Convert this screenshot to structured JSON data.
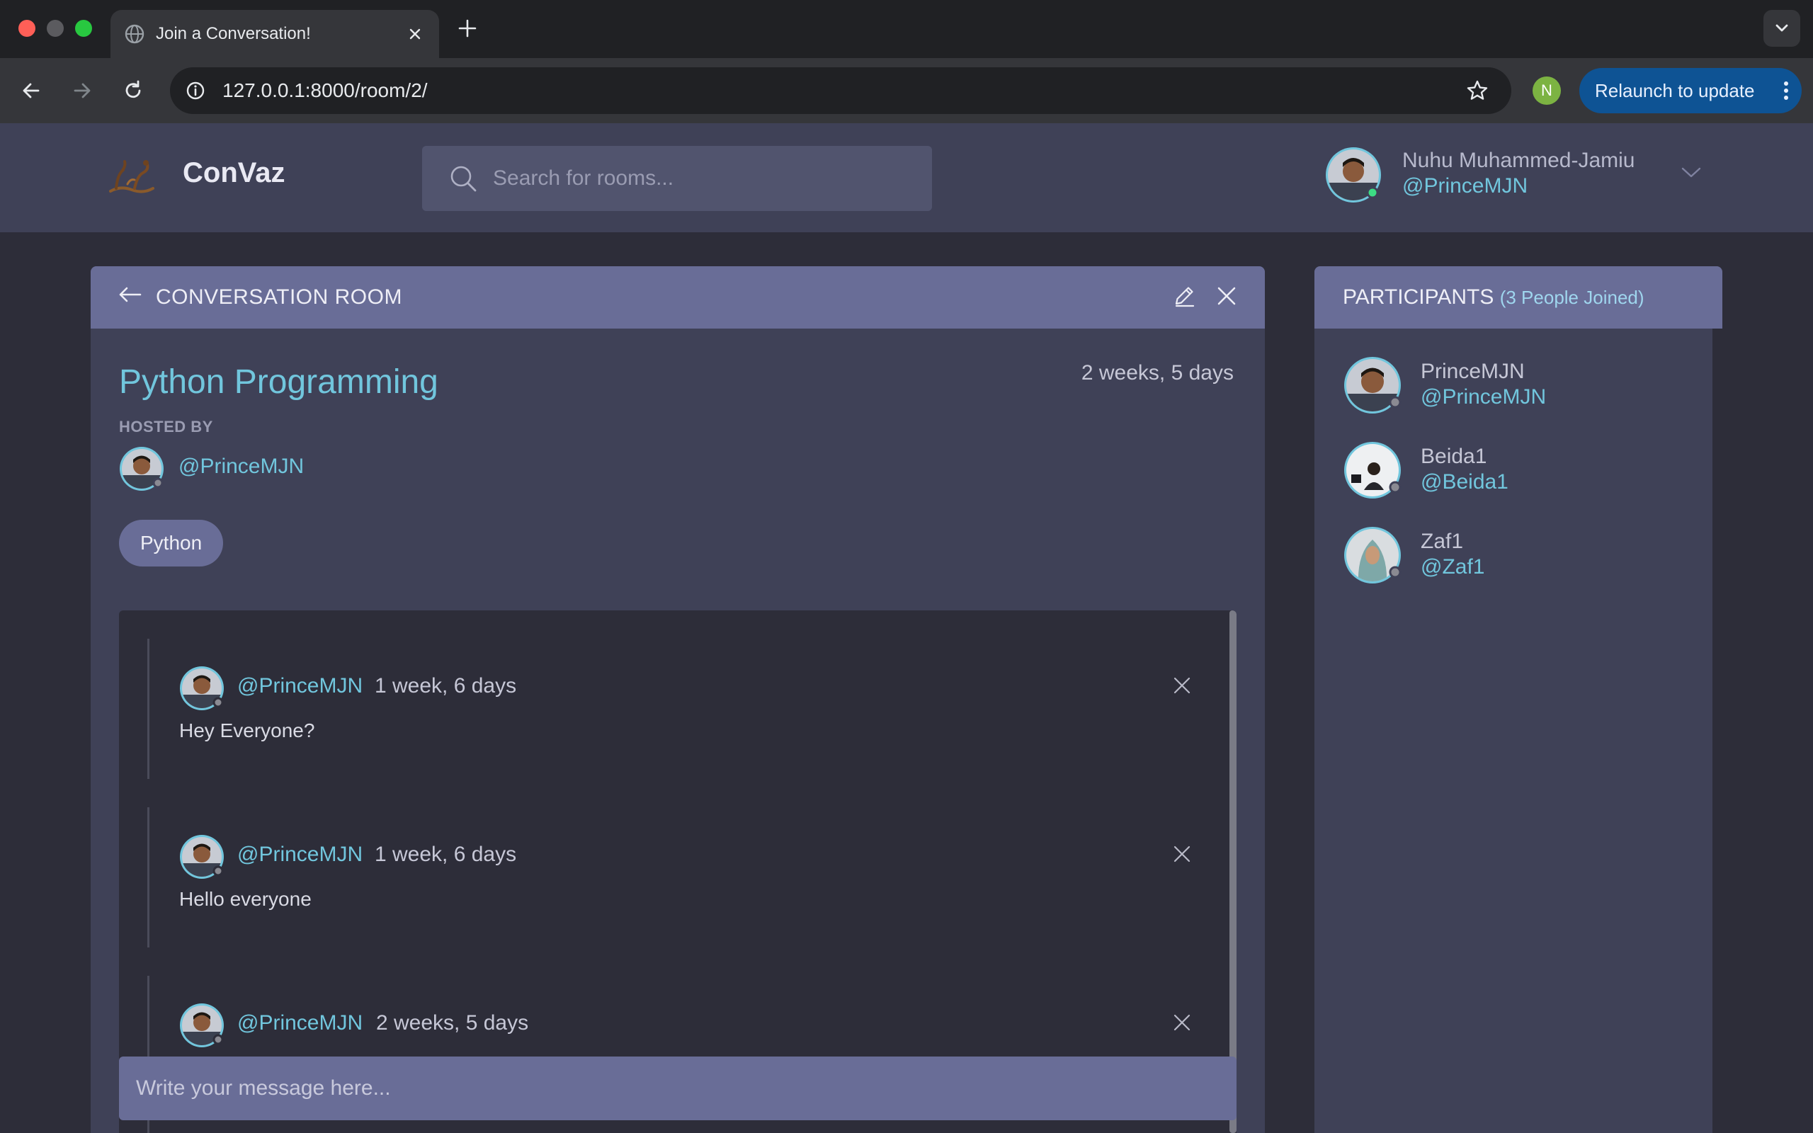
{
  "browser": {
    "tab_title": "Join a Conversation!",
    "url": "127.0.0.1:8000/room/2/",
    "profile_initial": "N",
    "relaunch_label": "Relaunch to update"
  },
  "header": {
    "brand": "ConVaz",
    "search_placeholder": "Search for rooms...",
    "user_name": "Nuhu Muhammed-Jamiu",
    "user_handle": "@PrinceMJN"
  },
  "room": {
    "header_title": "CONVERSATION ROOM",
    "title": "Python Programming",
    "created_ago": "2 weeks, 5 days",
    "hosted_by_label": "HOSTED BY",
    "host_handle": "@PrinceMJN",
    "topic": "Python",
    "messages": [
      {
        "handle": "@PrinceMJN",
        "time": "1 week, 6 days",
        "body": "Hey Everyone?"
      },
      {
        "handle": "@PrinceMJN",
        "time": "1 week, 6 days",
        "body": "Hello everyone"
      },
      {
        "handle": "@PrinceMJN",
        "time": "2 weeks, 5 days",
        "body": ""
      }
    ],
    "composer_placeholder": "Write your message here..."
  },
  "participants": {
    "title": "PARTICIPANTS",
    "count_label": "(3 People Joined)",
    "list": [
      {
        "name": "PrinceMJN",
        "handle": "@PrinceMJN"
      },
      {
        "name": "Beida1",
        "handle": "@Beida1"
      },
      {
        "name": "Zaf1",
        "handle": "@Zaf1"
      }
    ]
  },
  "colors": {
    "page_bg": "#2d2d39",
    "card_bg": "#3f4157",
    "card_header": "#696d97",
    "accent": "#71c6dd",
    "online": "#3ddc84",
    "offline": "#8a8a92"
  },
  "icons": [
    "globe-icon",
    "close-icon",
    "plus-icon",
    "chevron-down-icon",
    "back-arrow-icon",
    "forward-arrow-icon",
    "reload-icon",
    "info-icon",
    "star-icon",
    "kebab-menu-icon",
    "logo-icon",
    "search-icon",
    "edit-icon",
    "avatar-icon"
  ]
}
